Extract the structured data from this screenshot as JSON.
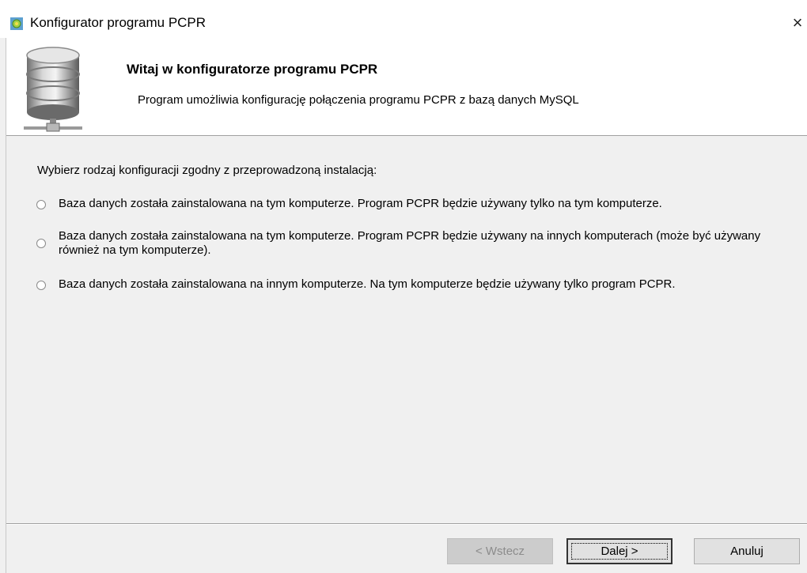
{
  "window": {
    "title": "Konfigurator programu PCPR",
    "close_glyph": "×"
  },
  "header": {
    "title": "Witaj w konfiguratorze programu PCPR",
    "subtitle": "Program umożliwia konfigurację połączenia programu PCPR z bazą danych MySQL",
    "icon": "database-network-icon"
  },
  "main": {
    "prompt": "Wybierz rodzaj konfiguracji zgodny z przeprowadzoną instalacją:",
    "options": [
      {
        "label": "Baza danych została zainstalowana na tym komputerze. Program PCPR będzie używany tylko na tym komputerze.",
        "selected": false
      },
      {
        "label": "Baza danych została zainstalowana na tym komputerze. Program PCPR będzie używany na innych komputerach (może być używany również na tym komputerze).",
        "selected": false
      },
      {
        "label": "Baza danych została zainstalowana na innym komputerze. Na tym komputerze będzie używany tylko program PCPR.",
        "selected": false
      }
    ]
  },
  "footer": {
    "back_label": "< Wstecz",
    "next_label": "Dalej >",
    "cancel_label": "Anuluj"
  }
}
